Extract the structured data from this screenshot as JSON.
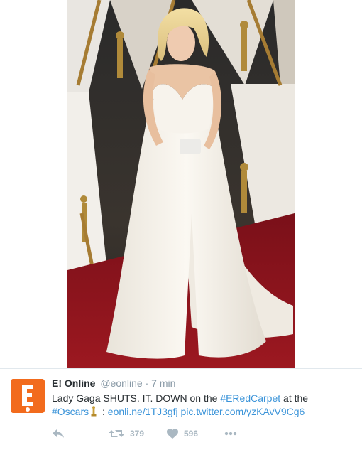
{
  "photo": {
    "subject": "Lady Gaga on the Oscars red carpet in a white strapless gown"
  },
  "tweet": {
    "author_name": "E! Online",
    "author_handle": "@eonline",
    "separator": "·",
    "timestamp": "7 min",
    "text_1": "Lady Gaga SHUTS. IT. DOWN on the ",
    "hashtag_1": "#ERedCarpet",
    "text_2": " at the",
    "hashtag_2": "#Oscars",
    "text_3": " : ",
    "link_1": "eonli.ne/1TJ3gfj",
    "text_4": " ",
    "link_2": "pic.twitter.com/yzKAvV9Cg6"
  },
  "actions": {
    "retweet_count": "379",
    "like_count": "596"
  },
  "colors": {
    "link": "#3b94d9",
    "brand_orange": "#f26b1d",
    "muted": "#8899a6",
    "action_icon": "#aab8c2"
  }
}
